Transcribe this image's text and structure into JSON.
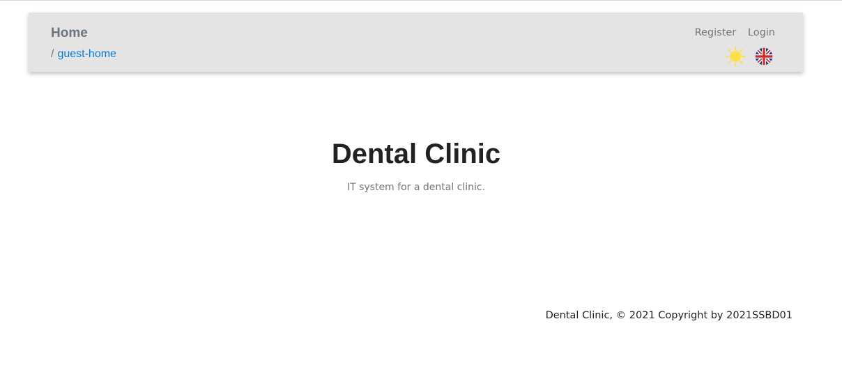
{
  "navbar": {
    "title": "Home",
    "breadcrumb": {
      "separator": "/",
      "current": "guest-home"
    },
    "links": {
      "register": "Register",
      "login": "Login"
    },
    "icons": {
      "theme": "sun-icon",
      "language": "uk-flag-icon"
    }
  },
  "hero": {
    "title": "Dental Clinic",
    "subtitle": "IT system for a dental clinic."
  },
  "footer": {
    "text": "Dental Clinic, © 2021 Copyright by 2021SSBD01"
  },
  "colors": {
    "navbar_bg": "#e4e4e4",
    "link_blue": "#0a7be0",
    "muted": "#6c757d",
    "sun": "#fde047"
  }
}
